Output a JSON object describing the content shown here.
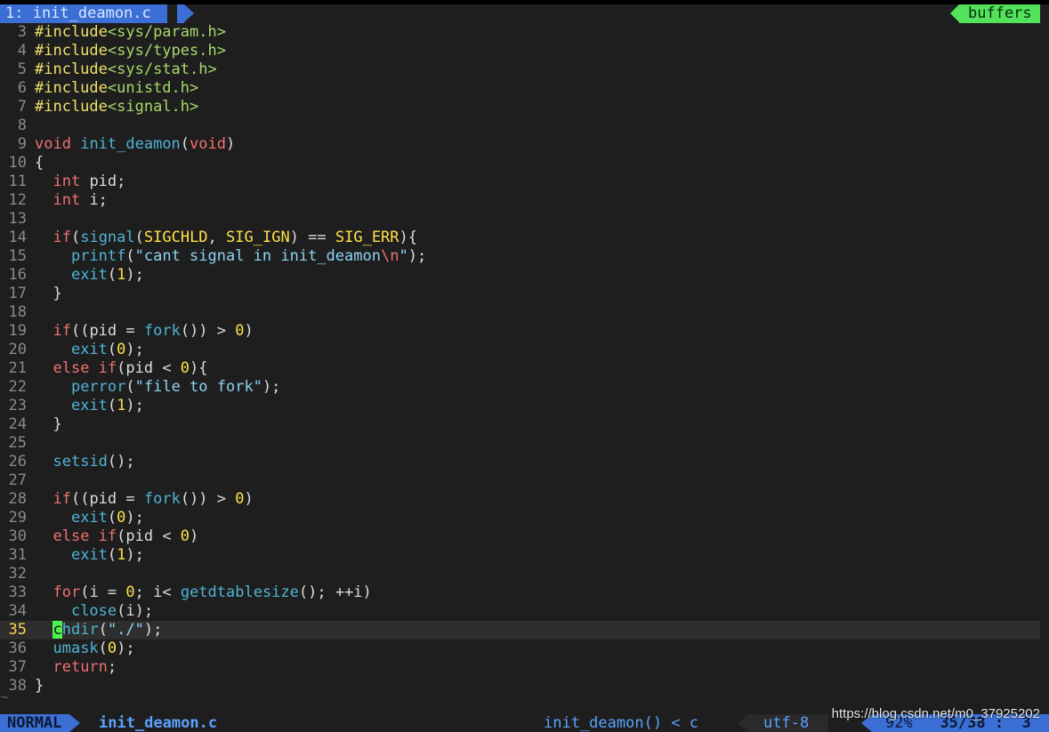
{
  "tabline": {
    "active_tab": "1: init_deamon.c",
    "buffers_label": "buffers"
  },
  "editor": {
    "lines": [
      {
        "num": "3",
        "parts": [
          {
            "t": "#include",
            "c": "pp"
          },
          {
            "t": "<sys/param.h>",
            "c": "inc"
          }
        ]
      },
      {
        "num": "4",
        "parts": [
          {
            "t": "#include",
            "c": "pp"
          },
          {
            "t": "<sys/types.h>",
            "c": "inc"
          }
        ]
      },
      {
        "num": "5",
        "parts": [
          {
            "t": "#include",
            "c": "pp"
          },
          {
            "t": "<sys/stat.h>",
            "c": "inc"
          }
        ]
      },
      {
        "num": "6",
        "parts": [
          {
            "t": "#include",
            "c": "pp"
          },
          {
            "t": "<unistd.h>",
            "c": "inc"
          }
        ]
      },
      {
        "num": "7",
        "parts": [
          {
            "t": "#include",
            "c": "pp"
          },
          {
            "t": "<signal.h>",
            "c": "inc"
          }
        ]
      },
      {
        "num": "8",
        "parts": []
      },
      {
        "num": "9",
        "parts": [
          {
            "t": "void",
            "c": "kw"
          },
          {
            "t": " "
          },
          {
            "t": "init_deamon",
            "c": "fn"
          },
          {
            "t": "("
          },
          {
            "t": "void",
            "c": "kw"
          },
          {
            "t": ")"
          }
        ]
      },
      {
        "num": "10",
        "parts": [
          {
            "t": "{"
          }
        ]
      },
      {
        "num": "11",
        "parts": [
          {
            "t": "  "
          },
          {
            "t": "int",
            "c": "kw"
          },
          {
            "t": " pid;"
          }
        ]
      },
      {
        "num": "12",
        "parts": [
          {
            "t": "  "
          },
          {
            "t": "int",
            "c": "kw"
          },
          {
            "t": " i;"
          }
        ]
      },
      {
        "num": "13",
        "parts": []
      },
      {
        "num": "14",
        "parts": [
          {
            "t": "  "
          },
          {
            "t": "if",
            "c": "kw"
          },
          {
            "t": "("
          },
          {
            "t": "signal",
            "c": "fn"
          },
          {
            "t": "("
          },
          {
            "t": "SIGCHLD",
            "c": "const"
          },
          {
            "t": ", "
          },
          {
            "t": "SIG_IGN",
            "c": "const"
          },
          {
            "t": ") == "
          },
          {
            "t": "SIG_ERR",
            "c": "const"
          },
          {
            "t": "){"
          }
        ]
      },
      {
        "num": "15",
        "parts": [
          {
            "t": "    "
          },
          {
            "t": "printf",
            "c": "fn"
          },
          {
            "t": "("
          },
          {
            "t": "\"cant signal in init_deamon",
            "c": "str"
          },
          {
            "t": "\\n",
            "c": "esc"
          },
          {
            "t": "\"",
            "c": "str"
          },
          {
            "t": ");"
          }
        ]
      },
      {
        "num": "16",
        "parts": [
          {
            "t": "    "
          },
          {
            "t": "exit",
            "c": "fn"
          },
          {
            "t": "("
          },
          {
            "t": "1",
            "c": "num"
          },
          {
            "t": ");"
          }
        ]
      },
      {
        "num": "17",
        "parts": [
          {
            "t": "  }"
          }
        ]
      },
      {
        "num": "18",
        "parts": []
      },
      {
        "num": "19",
        "parts": [
          {
            "t": "  "
          },
          {
            "t": "if",
            "c": "kw"
          },
          {
            "t": "((pid = "
          },
          {
            "t": "fork",
            "c": "fn"
          },
          {
            "t": "()) > "
          },
          {
            "t": "0",
            "c": "num"
          },
          {
            "t": ")"
          }
        ]
      },
      {
        "num": "20",
        "parts": [
          {
            "t": "    "
          },
          {
            "t": "exit",
            "c": "fn"
          },
          {
            "t": "("
          },
          {
            "t": "0",
            "c": "num"
          },
          {
            "t": ");"
          }
        ]
      },
      {
        "num": "21",
        "parts": [
          {
            "t": "  "
          },
          {
            "t": "else if",
            "c": "kw"
          },
          {
            "t": "(pid < "
          },
          {
            "t": "0",
            "c": "num"
          },
          {
            "t": "){"
          }
        ]
      },
      {
        "num": "22",
        "parts": [
          {
            "t": "    "
          },
          {
            "t": "perror",
            "c": "fn"
          },
          {
            "t": "("
          },
          {
            "t": "\"file to fork\"",
            "c": "str"
          },
          {
            "t": ");"
          }
        ]
      },
      {
        "num": "23",
        "parts": [
          {
            "t": "    "
          },
          {
            "t": "exit",
            "c": "fn"
          },
          {
            "t": "("
          },
          {
            "t": "1",
            "c": "num"
          },
          {
            "t": ");"
          }
        ]
      },
      {
        "num": "24",
        "parts": [
          {
            "t": "  }"
          }
        ]
      },
      {
        "num": "25",
        "parts": []
      },
      {
        "num": "26",
        "parts": [
          {
            "t": "  "
          },
          {
            "t": "setsid",
            "c": "fn"
          },
          {
            "t": "();"
          }
        ]
      },
      {
        "num": "27",
        "parts": []
      },
      {
        "num": "28",
        "parts": [
          {
            "t": "  "
          },
          {
            "t": "if",
            "c": "kw"
          },
          {
            "t": "((pid = "
          },
          {
            "t": "fork",
            "c": "fn"
          },
          {
            "t": "()) > "
          },
          {
            "t": "0",
            "c": "num"
          },
          {
            "t": ")"
          }
        ]
      },
      {
        "num": "29",
        "parts": [
          {
            "t": "    "
          },
          {
            "t": "exit",
            "c": "fn"
          },
          {
            "t": "("
          },
          {
            "t": "0",
            "c": "num"
          },
          {
            "t": ");"
          }
        ]
      },
      {
        "num": "30",
        "parts": [
          {
            "t": "  "
          },
          {
            "t": "else if",
            "c": "kw"
          },
          {
            "t": "(pid < "
          },
          {
            "t": "0",
            "c": "num"
          },
          {
            "t": ")"
          }
        ]
      },
      {
        "num": "31",
        "parts": [
          {
            "t": "    "
          },
          {
            "t": "exit",
            "c": "fn"
          },
          {
            "t": "("
          },
          {
            "t": "1",
            "c": "num"
          },
          {
            "t": ");"
          }
        ]
      },
      {
        "num": "32",
        "parts": []
      },
      {
        "num": "33",
        "parts": [
          {
            "t": "  "
          },
          {
            "t": "for",
            "c": "kw"
          },
          {
            "t": "(i = "
          },
          {
            "t": "0",
            "c": "num"
          },
          {
            "t": "; i< "
          },
          {
            "t": "getdtablesize",
            "c": "fn"
          },
          {
            "t": "(); ++i)"
          }
        ]
      },
      {
        "num": "34",
        "parts": [
          {
            "t": "    "
          },
          {
            "t": "close",
            "c": "fn"
          },
          {
            "t": "(i);"
          }
        ]
      },
      {
        "num": "35",
        "cur": true,
        "parts": [
          {
            "t": "  "
          },
          {
            "t": "c",
            "c": "cursor"
          },
          {
            "t": "hdir",
            "c": "fn"
          },
          {
            "t": "("
          },
          {
            "t": "\"./\"",
            "c": "str"
          },
          {
            "t": ");"
          }
        ]
      },
      {
        "num": "36",
        "parts": [
          {
            "t": "  "
          },
          {
            "t": "umask",
            "c": "fn"
          },
          {
            "t": "("
          },
          {
            "t": "0",
            "c": "num"
          },
          {
            "t": ");"
          }
        ]
      },
      {
        "num": "37",
        "parts": [
          {
            "t": "  "
          },
          {
            "t": "return",
            "c": "kw"
          },
          {
            "t": ";"
          }
        ]
      },
      {
        "num": "38",
        "parts": [
          {
            "t": "}"
          }
        ]
      }
    ],
    "tilde": "~"
  },
  "statusline": {
    "mode": "NORMAL",
    "filename": "init_deamon.c",
    "function": "init_deamon() < c",
    "encoding": "utf-8",
    "percent": "92%",
    "position": "35/38 :  3"
  },
  "watermark": "https://blog.csdn.net/m0_37925202"
}
